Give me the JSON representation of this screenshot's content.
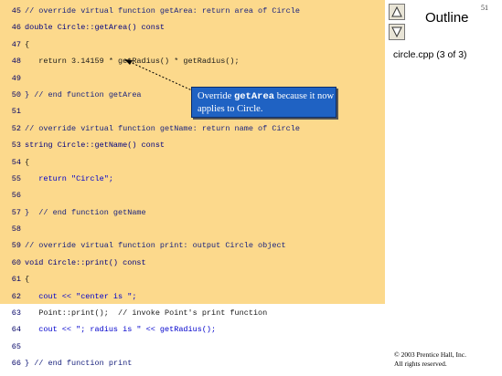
{
  "slide_number": "51",
  "outline_title": "Outline",
  "file_label": "circle.cpp (3 of 3)",
  "nav": {
    "up_icon": "triangle-up-icon",
    "down_icon": "triangle-down-icon"
  },
  "code_lines": [
    {
      "num": "45",
      "text": "// override virtual function getArea: return area of Circle",
      "kind": "comment"
    },
    {
      "num": "46",
      "text": "double Circle::getArea() const",
      "kind": "keyword"
    },
    {
      "num": "47",
      "text": "{",
      "kind": "plain"
    },
    {
      "num": "48",
      "text": "   return 3.14159 * getRadius() * getRadius();",
      "kind": "plain"
    },
    {
      "num": "49",
      "text": "",
      "kind": "plain"
    },
    {
      "num": "50",
      "text": "} // end function getArea",
      "kind": "comment"
    },
    {
      "num": "51",
      "text": "",
      "kind": "plain"
    },
    {
      "num": "52",
      "text": "// override virtual function getName: return name of Circle",
      "kind": "comment"
    },
    {
      "num": "53",
      "text": "string Circle::getName() const",
      "kind": "keyword"
    },
    {
      "num": "54",
      "text": "{",
      "kind": "plain"
    },
    {
      "num": "55",
      "text": "   return \"Circle\";",
      "kind": "string"
    },
    {
      "num": "56",
      "text": "",
      "kind": "plain"
    },
    {
      "num": "57",
      "text": "}  // end function getName",
      "kind": "comment"
    },
    {
      "num": "58",
      "text": "",
      "kind": "plain"
    },
    {
      "num": "59",
      "text": "// override virtual function print: output Circle object",
      "kind": "comment"
    },
    {
      "num": "60",
      "text": "void Circle::print() const",
      "kind": "keyword"
    },
    {
      "num": "61",
      "text": "{",
      "kind": "plain"
    },
    {
      "num": "62",
      "text": "   cout << \"center is \";",
      "kind": "string"
    },
    {
      "num": "63",
      "text": "   Point::print();  // invoke Point's print function",
      "kind": "plain"
    },
    {
      "num": "64",
      "text": "   cout << \"; radius is \" << getRadius();",
      "kind": "string"
    },
    {
      "num": "65",
      "text": "",
      "kind": "plain"
    },
    {
      "num": "66",
      "text": "} // end function print",
      "kind": "comment"
    }
  ],
  "callout": {
    "prefix": "Override ",
    "code": "getArea",
    "suffix": " because it now applies to Circle."
  },
  "copyright": {
    "line1": "© 2003 Prentice Hall, Inc.",
    "line2": "All rights reserved."
  },
  "colors": {
    "code_background": "#fcd98c",
    "callout_background": "#1f62c3"
  }
}
